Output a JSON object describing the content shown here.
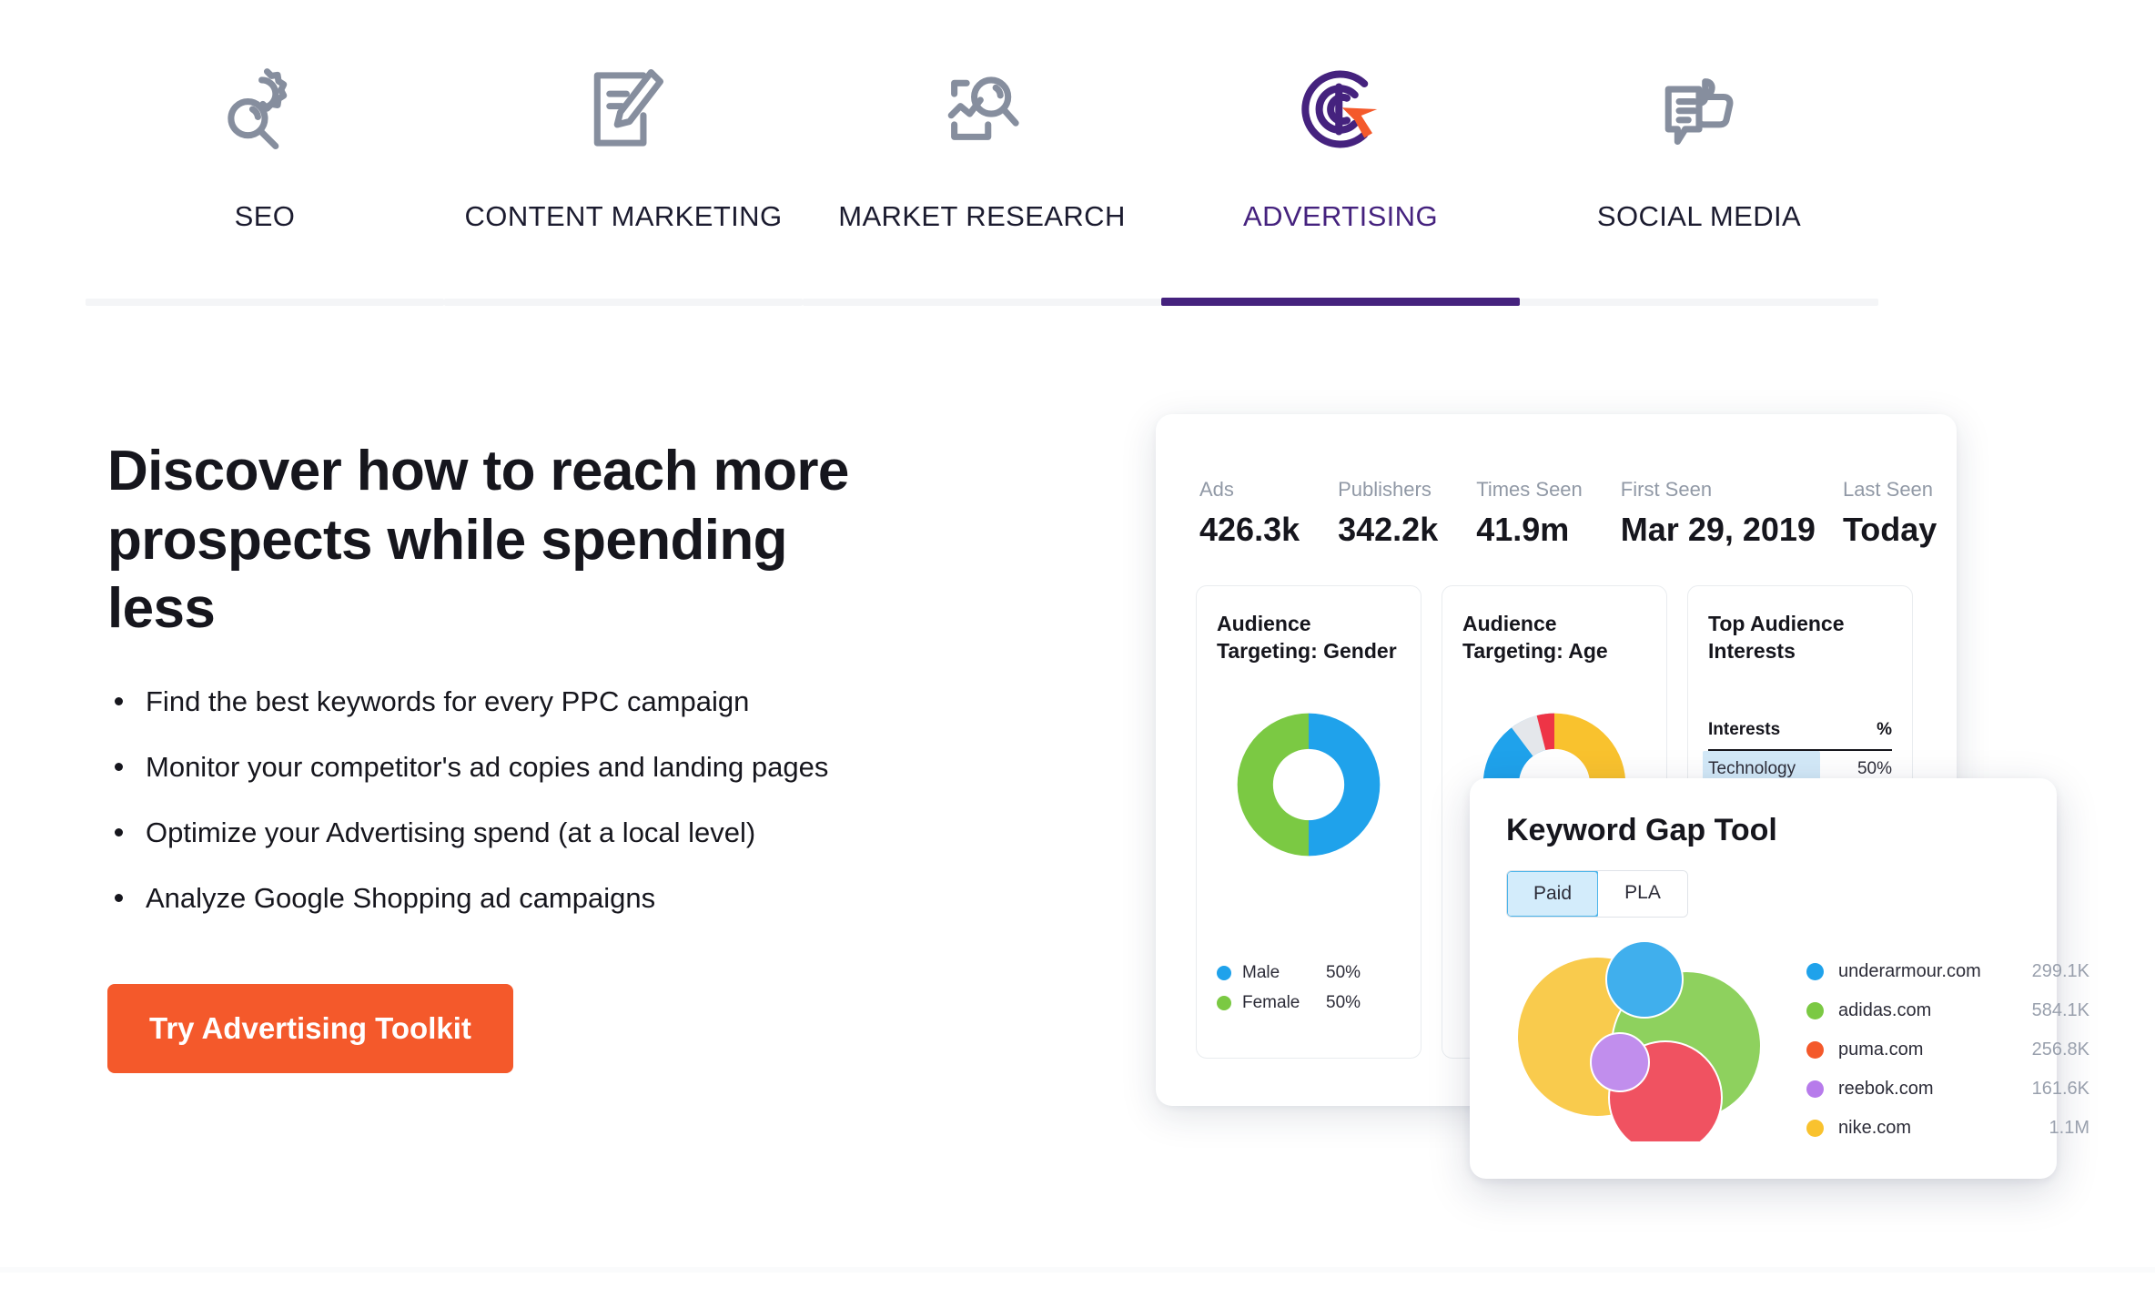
{
  "tabs": [
    {
      "label": "SEO",
      "icon": "seo-gear-magnifier-icon",
      "active": false
    },
    {
      "label": "CONTENT MARKETING",
      "icon": "document-pencil-icon",
      "active": false
    },
    {
      "label": "MARKET RESEARCH",
      "icon": "chart-magnifier-icon",
      "active": false
    },
    {
      "label": "ADVERTISING",
      "icon": "target-dollar-cursor-icon",
      "active": true
    },
    {
      "label": "SOCIAL MEDIA",
      "icon": "speech-bubble-thumbsup-icon",
      "active": false
    }
  ],
  "hero": {
    "headline": "Discover how to reach more prospects while spending less",
    "bullets": [
      "Find the best keywords for every PPC campaign",
      "Monitor your competitor's ad copies and landing pages",
      "Optimize your Advertising spend (at a local level)",
      "Analyze Google Shopping ad campaigns"
    ],
    "cta_label": "Try Advertising Toolkit"
  },
  "colors": {
    "accent_purple": "#45227E",
    "cta_orange": "#F4592B",
    "blue": "#1FA2EB",
    "green": "#7BC943",
    "yellow": "#F9C22E",
    "red": "#EE3446",
    "purple_bubble": "#B77BEB",
    "gray": "#E4E7EB"
  },
  "dashboard": {
    "stats": [
      {
        "label": "Ads",
        "value": "426.3k"
      },
      {
        "label": "Publishers",
        "value": "342.2k"
      },
      {
        "label": "Times Seen",
        "value": "41.9m"
      },
      {
        "label": "First Seen",
        "value": "Mar 29, 2019"
      },
      {
        "label": "Last Seen",
        "value": "Today"
      }
    ],
    "gender_card": {
      "title": "Audience Targeting: Gender",
      "legend": [
        {
          "name": "Male",
          "value": "50%",
          "color": "#1FA2EB"
        },
        {
          "name": "Female",
          "value": "50%",
          "color": "#7BC943"
        }
      ]
    },
    "age_card": {
      "title": "Audience Targeting: Age"
    },
    "interests_card": {
      "title": "Top Audience Interests",
      "col_name": "Interests",
      "col_pct": "%",
      "rows": [
        {
          "name": "Technology",
          "pct": "50%"
        }
      ]
    }
  },
  "keyword_gap": {
    "title": "Keyword Gap Tool",
    "tabs": [
      {
        "label": "Paid",
        "active": true
      },
      {
        "label": "PLA",
        "active": false
      }
    ],
    "legend": [
      {
        "name": "underarmour.com",
        "value": "299.1K",
        "color": "#1FA2EB"
      },
      {
        "name": "adidas.com",
        "value": "584.1K",
        "color": "#7BC943"
      },
      {
        "name": "puma.com",
        "value": "256.8K",
        "color": "#F4592B"
      },
      {
        "name": "reebok.com",
        "value": "161.6K",
        "color": "#B77BEB"
      },
      {
        "name": "nike.com",
        "value": "1.1M",
        "color": "#F9C22E"
      }
    ]
  },
  "chart_data": [
    {
      "type": "pie",
      "title": "Audience Targeting: Gender",
      "labels": [
        "Male",
        "Female"
      ],
      "values": [
        50,
        50
      ],
      "colors": [
        "#1FA2EB",
        "#7BC943"
      ],
      "legend_position": "bottom-left",
      "donut": true
    },
    {
      "type": "pie",
      "title": "Audience Targeting: Age",
      "labels": [
        "segment-gray",
        "segment-blue",
        "segment-yellow",
        "segment-red"
      ],
      "values": [
        18,
        30,
        24,
        4
      ],
      "colors": [
        "#E4E7EB",
        "#1FA2EB",
        "#F9C22E",
        "#EE3446"
      ],
      "donut": true
    },
    {
      "type": "table",
      "title": "Top Audience Interests",
      "columns": [
        "Interests",
        "%"
      ],
      "rows": [
        [
          "Technology",
          "50%"
        ]
      ]
    },
    {
      "type": "scatter",
      "title": "Keyword Gap Tool",
      "labels": [
        "nike.com",
        "adidas.com",
        "underarmour.com",
        "puma.com",
        "reebok.com"
      ],
      "values": [
        1100000,
        584100,
        299100,
        256800,
        161600
      ],
      "value_labels": [
        "1.1M",
        "584.1K",
        "299.1K",
        "256.8K",
        "161.6K"
      ],
      "colors": [
        "#F9C22E",
        "#7BC943",
        "#1FA2EB",
        "#F4592B",
        "#B77BEB"
      ]
    }
  ]
}
